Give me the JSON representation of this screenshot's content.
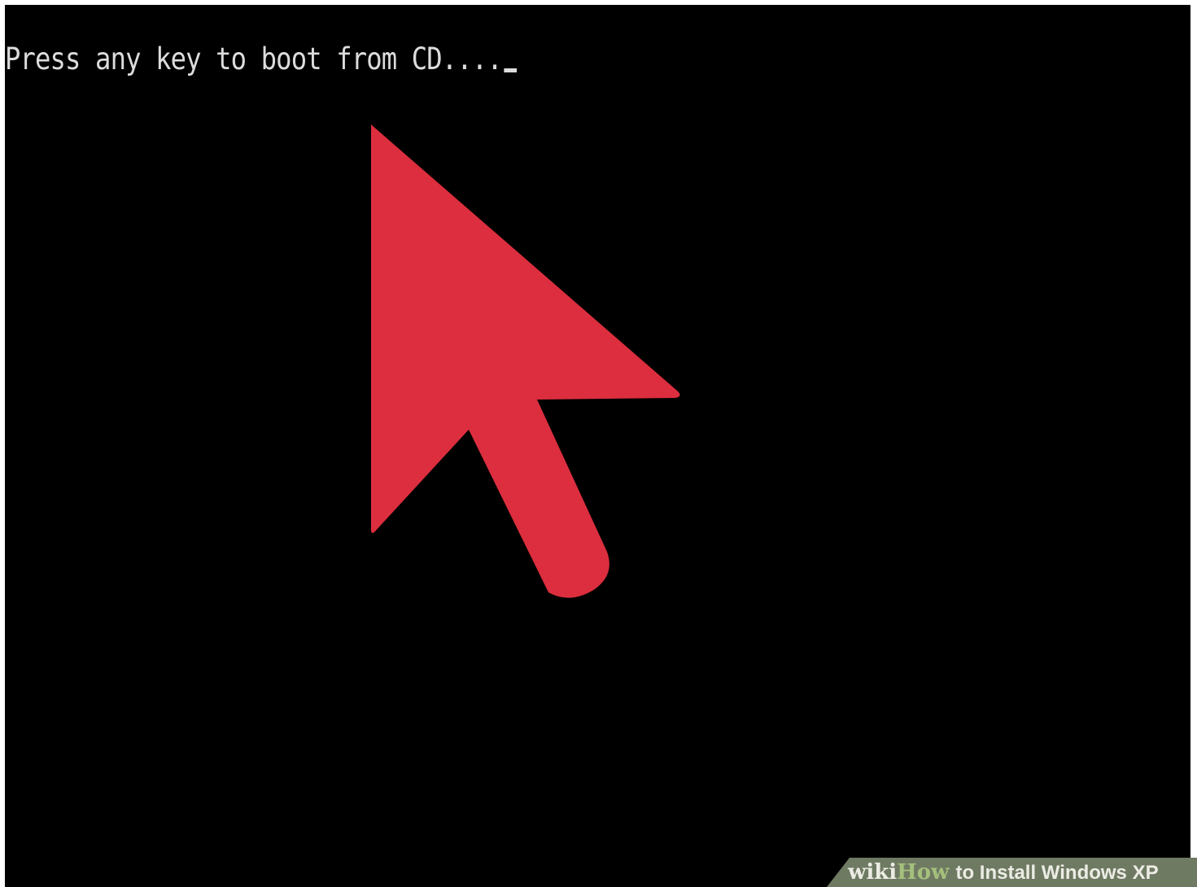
{
  "console": {
    "prompt": "Press any key to boot from CD....",
    "text_color": "#dcdcdc",
    "background_color": "#000000"
  },
  "annotation": {
    "icon": "red-pointer-arrow",
    "color": "#dc2e3e"
  },
  "watermark": {
    "wiki": "wiki",
    "how": "How",
    "title": "to Install Windows XP"
  }
}
